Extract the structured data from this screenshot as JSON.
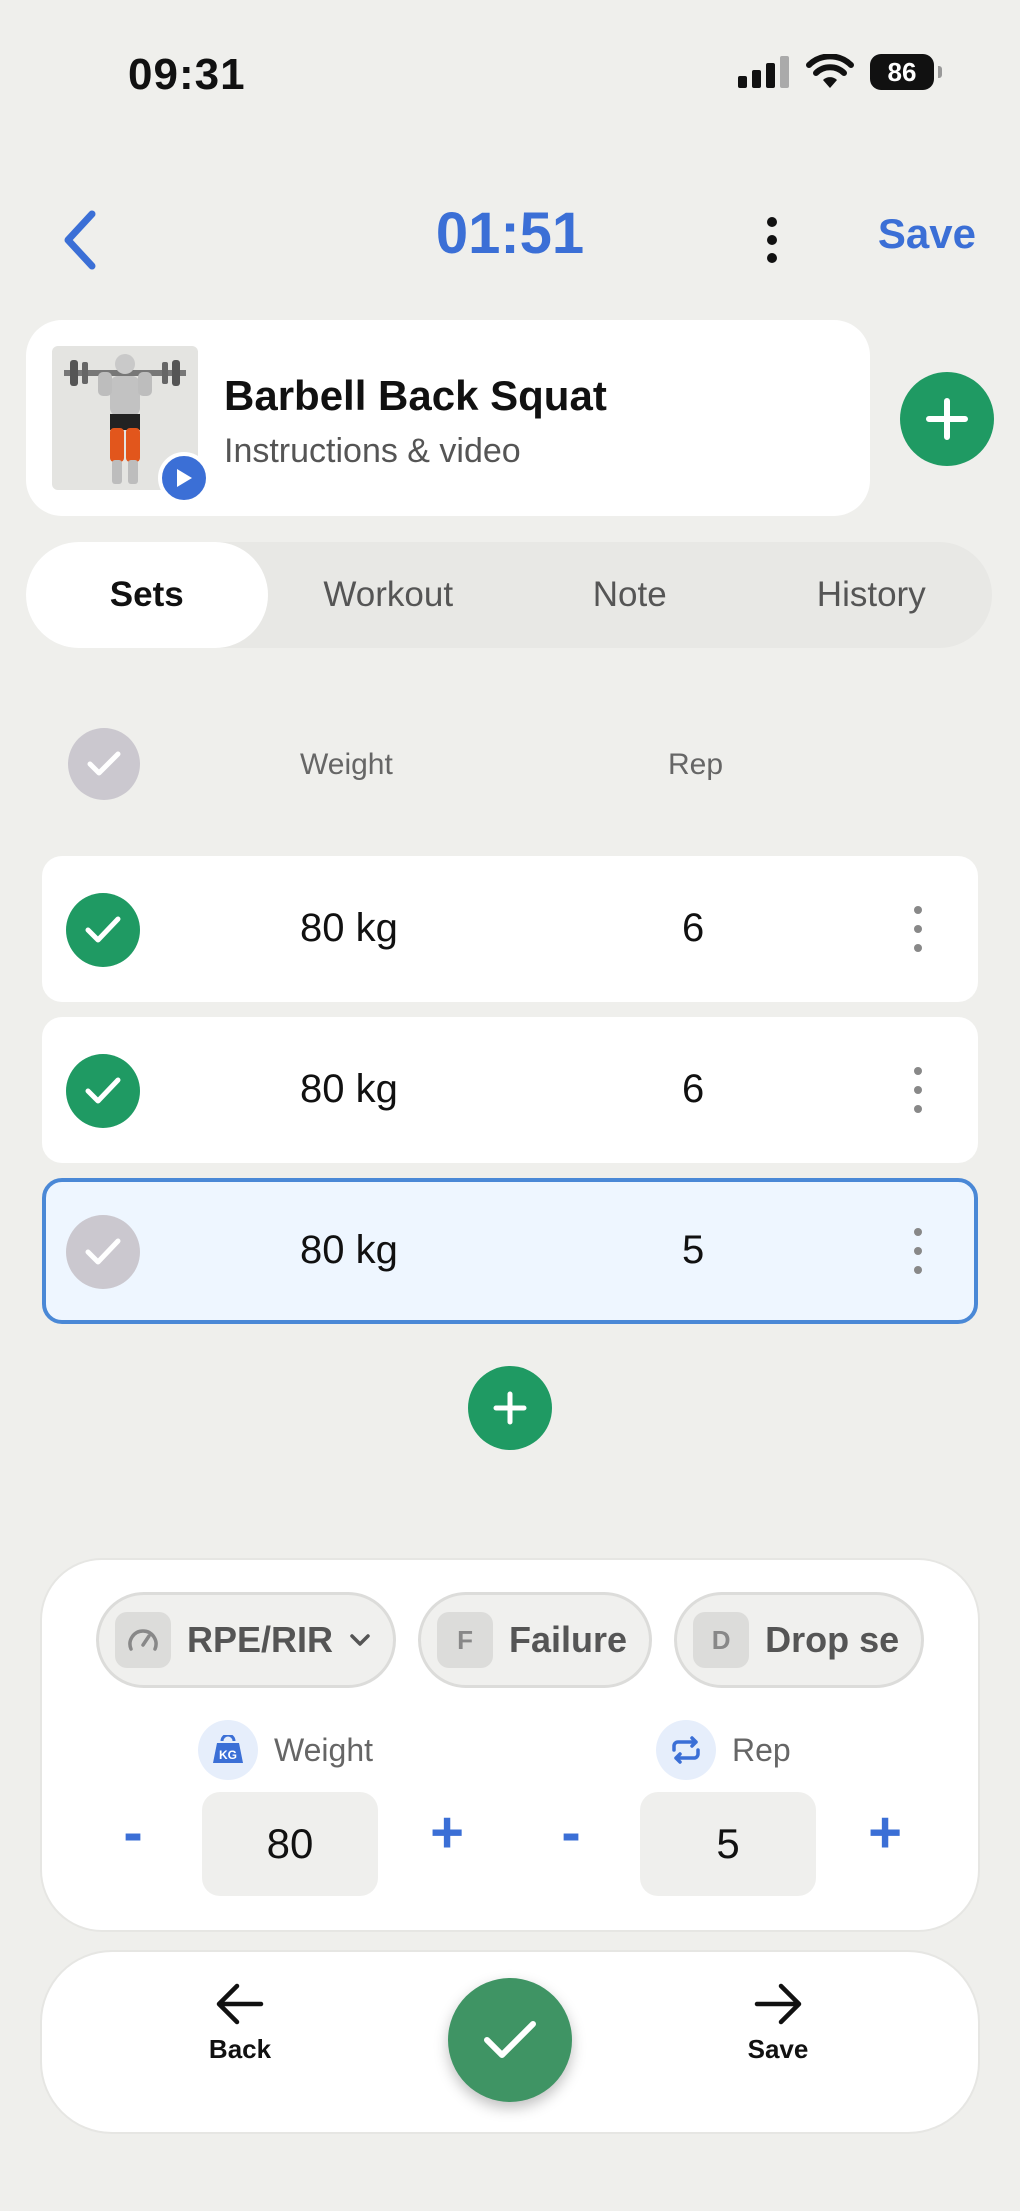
{
  "status_bar": {
    "time": "09:31",
    "battery": "86"
  },
  "header": {
    "timer": "01:51",
    "save_label": "Save"
  },
  "exercise": {
    "title": "Barbell Back Squat",
    "subtitle": "Instructions & video"
  },
  "tabs": [
    {
      "label": "Sets",
      "active": true
    },
    {
      "label": "Workout",
      "active": false
    },
    {
      "label": "Note",
      "active": false
    },
    {
      "label": "History",
      "active": false
    }
  ],
  "table": {
    "weight_header": "Weight",
    "rep_header": "Rep"
  },
  "sets": [
    {
      "weight": "80 kg",
      "rep": "6",
      "done": true
    },
    {
      "weight": "80 kg",
      "rep": "6",
      "done": true
    },
    {
      "weight": "80 kg",
      "rep": "5",
      "done": false
    }
  ],
  "panel": {
    "chips": [
      {
        "icon": "gauge-icon",
        "label": "RPE/RIR"
      },
      {
        "icon": "F",
        "label": "Failure"
      },
      {
        "icon": "D",
        "label": "Drop se"
      }
    ],
    "weight_label": "Weight",
    "rep_label": "Rep",
    "weight_value": "80",
    "rep_value": "5",
    "minus": "-",
    "plus": "+"
  },
  "bottom_nav": {
    "back_label": "Back",
    "save_label": "Save"
  },
  "colors": {
    "accent": "#3b6fd6",
    "success": "#1f9a63",
    "active_row_border": "#4a88d6"
  }
}
